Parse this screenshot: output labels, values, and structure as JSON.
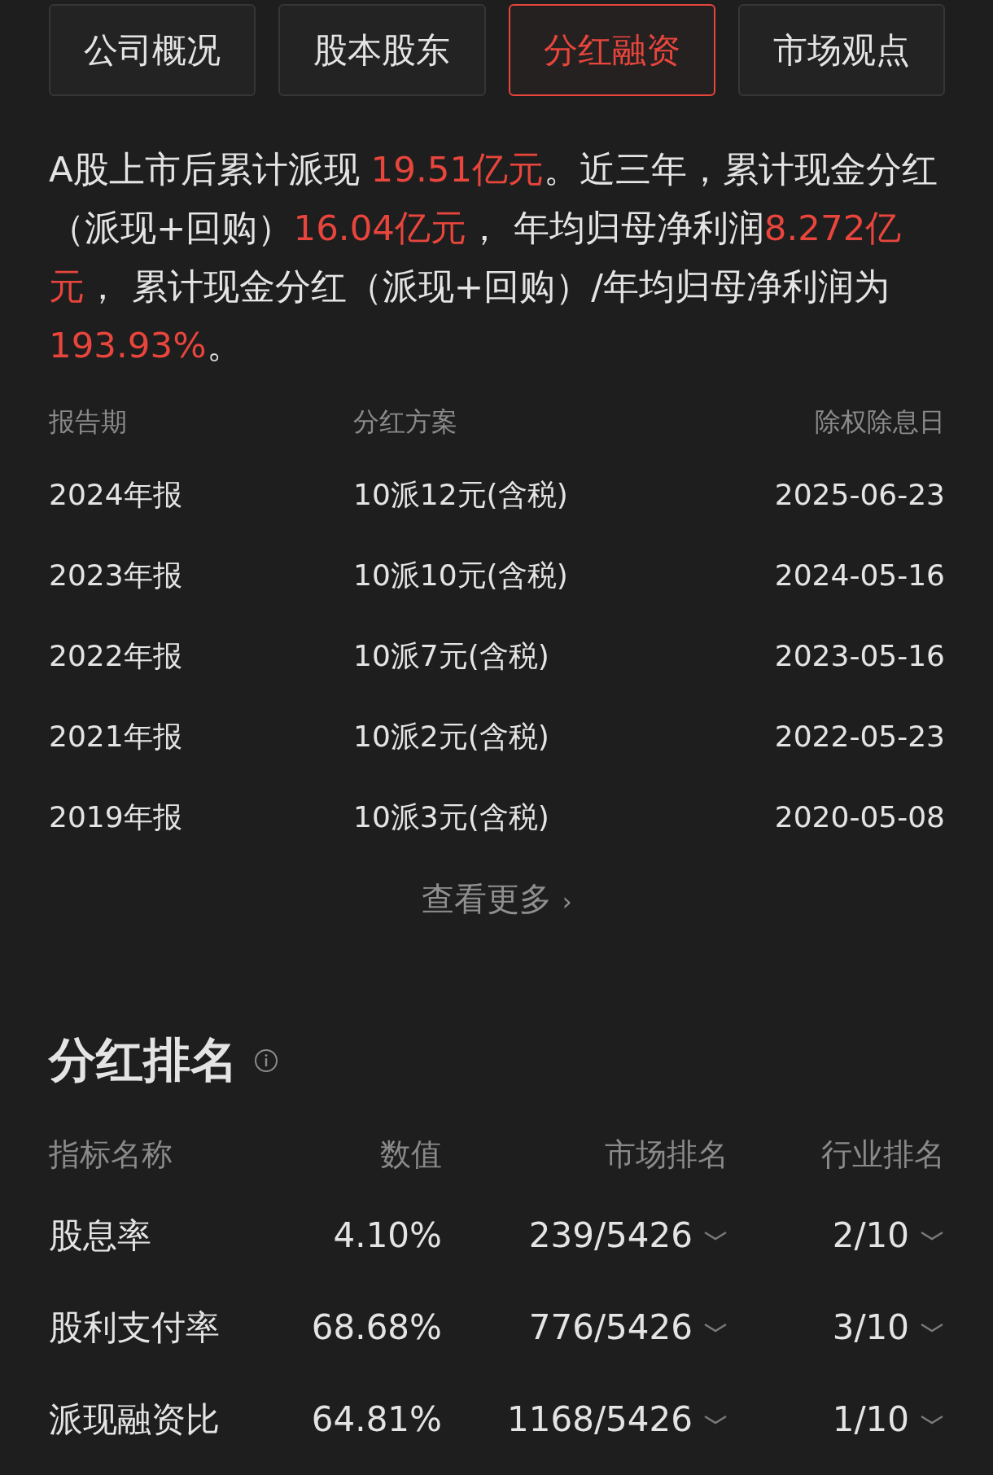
{
  "tabs": [
    {
      "label": "公司概况",
      "selected": false
    },
    {
      "label": "股本股东",
      "selected": false
    },
    {
      "label": "分红融资",
      "selected": true
    },
    {
      "label": "市场观点",
      "selected": false
    }
  ],
  "summary": [
    {
      "text": "A股上市后累计派现 ",
      "highlight": false
    },
    {
      "text": "19.51亿元",
      "highlight": true
    },
    {
      "text": "。近三年，累计现金分红（派现+回购）",
      "highlight": false
    },
    {
      "text": "16.04亿元",
      "highlight": true
    },
    {
      "text": "， 年均归母净利润",
      "highlight": false
    },
    {
      "text": "8.272亿元",
      "highlight": true
    },
    {
      "text": "， 累计现金分红（派现+回购）/年均归母净利润为",
      "highlight": false
    },
    {
      "text": "193.93%",
      "highlight": true
    },
    {
      "text": "。",
      "highlight": false
    }
  ],
  "dividend_table": {
    "columns": [
      "报告期",
      "分红方案",
      "除权除息日"
    ],
    "rows": [
      [
        "2024年报",
        "10派12元(含税)",
        "2025-06-23"
      ],
      [
        "2023年报",
        "10派10元(含税)",
        "2024-05-16"
      ],
      [
        "2022年报",
        "10派7元(含税)",
        "2023-05-16"
      ],
      [
        "2021年报",
        "10派2元(含税)",
        "2022-05-23"
      ],
      [
        "2019年报",
        "10派3元(含税)",
        "2020-05-08"
      ]
    ]
  },
  "more_link": {
    "label": "查看更多",
    "arrow": "›"
  },
  "ranking": {
    "title": "分红排名",
    "columns": [
      "指标名称",
      "数值",
      "市场排名",
      "行业排名"
    ],
    "rows": [
      [
        "股息率",
        "4.10%",
        "239/5426",
        "2/10"
      ],
      [
        "股利支付率",
        "68.68%",
        "776/5426",
        "3/10"
      ],
      [
        "派现融资比",
        "64.81%",
        "1168/5426",
        "1/10"
      ]
    ]
  }
}
